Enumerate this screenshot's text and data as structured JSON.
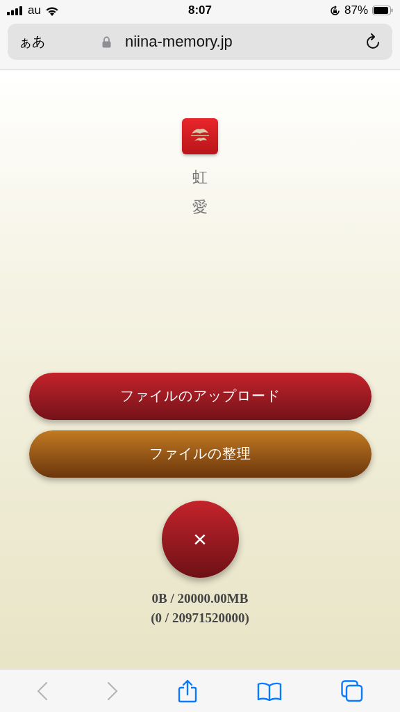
{
  "status_bar": {
    "carrier": "au",
    "time": "8:07",
    "battery": "87%"
  },
  "address_bar": {
    "text_size": "ぁあ",
    "url": "niina-memory.jp"
  },
  "profile": {
    "name": "虹愛"
  },
  "buttons": [
    {
      "label": "ファイルのアップロード",
      "kind": "primary"
    },
    {
      "label": "ファイルの整理",
      "kind": "secondary"
    }
  ],
  "close_button": {
    "label": "×"
  },
  "storage": {
    "used": "0B / 20000.00MB",
    "bytes": "(0 / 20971520000)"
  },
  "toolbar": {
    "back_disabled": true,
    "forward_disabled": true
  }
}
